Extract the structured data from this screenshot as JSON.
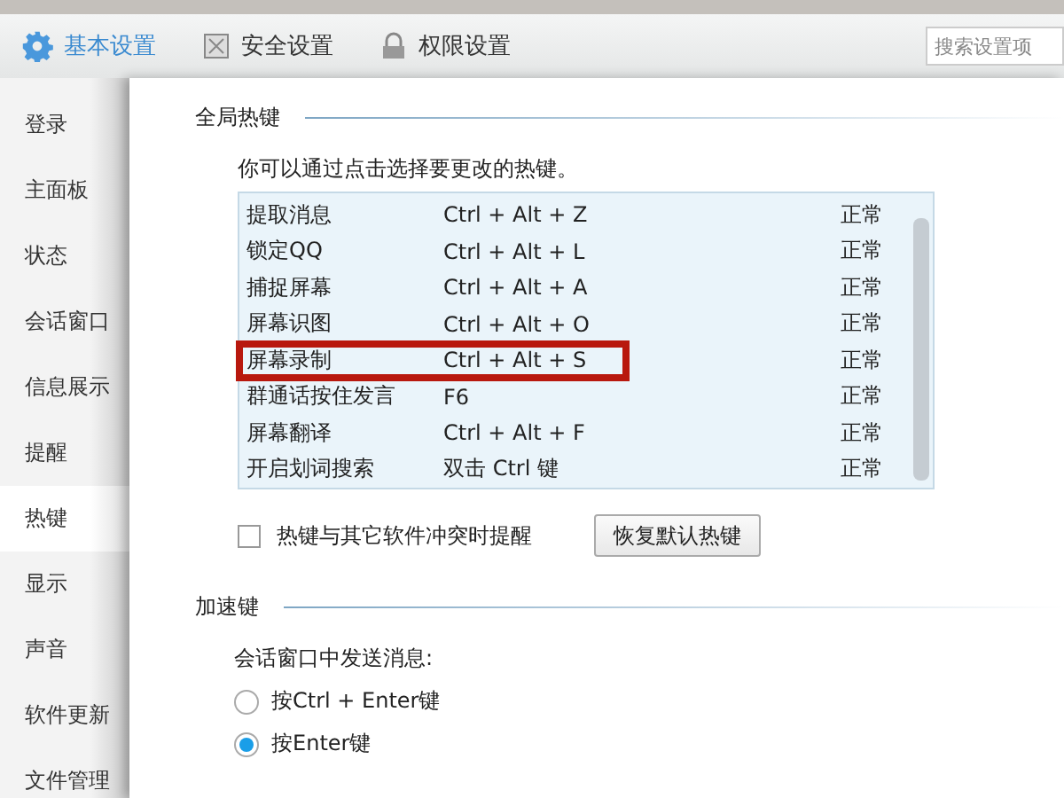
{
  "tabs": [
    {
      "label": "基本设置",
      "selected": true
    },
    {
      "label": "安全设置",
      "selected": false
    },
    {
      "label": "权限设置",
      "selected": false
    }
  ],
  "search": {
    "placeholder": "搜索设置项"
  },
  "sidebar": {
    "items": [
      {
        "label": "登录",
        "selected": false
      },
      {
        "label": "主面板",
        "selected": false
      },
      {
        "label": "状态",
        "selected": false
      },
      {
        "label": "会话窗口",
        "selected": false
      },
      {
        "label": "信息展示",
        "selected": false
      },
      {
        "label": "提醒",
        "selected": false
      },
      {
        "label": "热键",
        "selected": true
      },
      {
        "label": "显示",
        "selected": false
      },
      {
        "label": "声音",
        "selected": false
      },
      {
        "label": "软件更新",
        "selected": false
      },
      {
        "label": "文件管理",
        "selected": false
      }
    ]
  },
  "global_hotkeys": {
    "title": "全局热键",
    "description": "你可以通过点击选择要更改的热键。",
    "rows": [
      {
        "name": "提取消息",
        "keys": "Ctrl + Alt + Z",
        "status": "正常",
        "highlighted": false
      },
      {
        "name": "锁定QQ",
        "keys": "Ctrl + Alt + L",
        "status": "正常",
        "highlighted": false
      },
      {
        "name": "捕捉屏幕",
        "keys": "Ctrl + Alt + A",
        "status": "正常",
        "highlighted": false
      },
      {
        "name": "屏幕识图",
        "keys": "Ctrl + Alt + O",
        "status": "正常",
        "highlighted": false
      },
      {
        "name": "屏幕录制",
        "keys": "Ctrl + Alt + S",
        "status": "正常",
        "highlighted": true
      },
      {
        "name": "群通话按住发言",
        "keys": "F6",
        "status": "正常",
        "highlighted": false
      },
      {
        "name": "屏幕翻译",
        "keys": "Ctrl + Alt + F",
        "status": "正常",
        "highlighted": false
      },
      {
        "name": "开启划词搜索",
        "keys": "双击 Ctrl 键",
        "status": "正常",
        "highlighted": false
      }
    ],
    "conflict_checkbox": {
      "label": "热键与其它软件冲突时提醒",
      "checked": false
    },
    "restore_button": "恢复默认热键"
  },
  "accelerator": {
    "title": "加速键",
    "prompt": "会话窗口中发送消息:",
    "options": [
      {
        "label": "按Ctrl + Enter键",
        "selected": false
      },
      {
        "label": "按Enter键",
        "selected": true
      }
    ]
  }
}
